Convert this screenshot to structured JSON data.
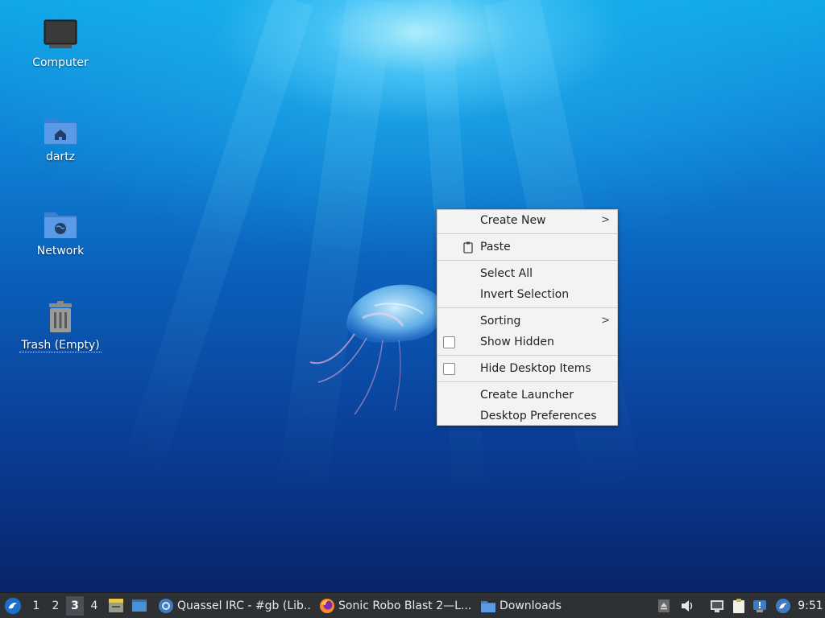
{
  "desktop_icons": [
    {
      "label": "Computer",
      "icon": "computer-icon"
    },
    {
      "label": "dartz",
      "icon": "home-folder-icon"
    },
    {
      "label": "Network",
      "icon": "network-folder-icon"
    },
    {
      "label": "Trash (Empty)",
      "icon": "trash-icon"
    }
  ],
  "context_menu": {
    "create_new": "Create New",
    "paste": "Paste",
    "select_all": "Select All",
    "invert_selection": "Invert Selection",
    "sorting": "Sorting",
    "show_hidden": "Show Hidden",
    "hide_desktop_items": "Hide Desktop Items",
    "create_launcher": "Create Launcher",
    "desktop_preferences": "Desktop Preferences",
    "submenu_arrow": ">"
  },
  "taskbar": {
    "workspaces": [
      "1",
      "2",
      "3",
      "4"
    ],
    "active_workspace": "3",
    "tasks": [
      {
        "label": "Quassel IRC - #gb (Lib...",
        "icon": "quassel-icon"
      },
      {
        "label": "Sonic Robo Blast 2—L...",
        "icon": "firefox-icon"
      },
      {
        "label": "Downloads",
        "icon": "folder-icon"
      }
    ],
    "clock": "9:51"
  },
  "colors": {
    "menu_bg": "#f3f3f3",
    "taskbar_bg": "#2e3134",
    "folder_blue": "#4a90d9"
  }
}
